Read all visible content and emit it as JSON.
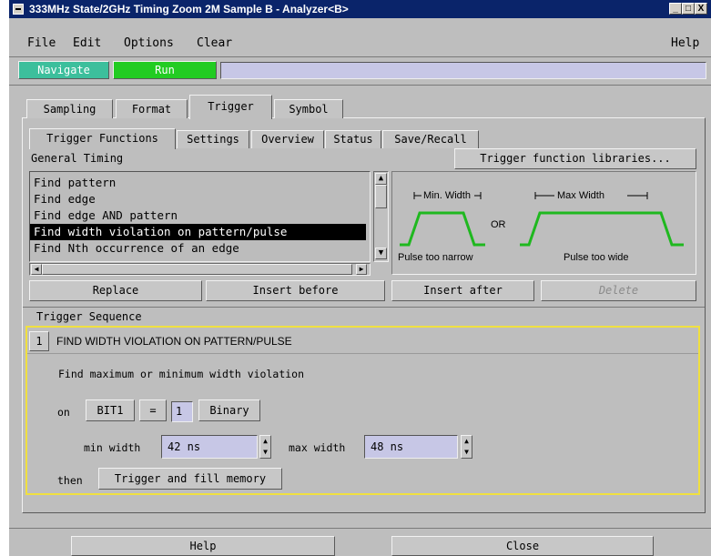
{
  "window": {
    "title": "333MHz State/2GHz Timing Zoom 2M Sample B - Analyzer<B>",
    "controls": [
      "_",
      "□",
      "X"
    ]
  },
  "menubar": {
    "items": [
      "File",
      "Edit",
      "Options",
      "Clear"
    ],
    "help": "Help"
  },
  "toolbar": {
    "navigate": "Navigate",
    "run": "Run",
    "status_text": ""
  },
  "main_tabs": [
    {
      "label": "Sampling"
    },
    {
      "label": "Format"
    },
    {
      "label": "Trigger"
    },
    {
      "label": "Symbol"
    }
  ],
  "sub_tabs": [
    {
      "label": "Trigger Functions"
    },
    {
      "label": "Settings"
    },
    {
      "label": "Overview"
    },
    {
      "label": "Status"
    },
    {
      "label": "Save/Recall"
    }
  ],
  "functions": {
    "category": "General Timing",
    "libraries_button": "Trigger function libraries...",
    "items": [
      {
        "label": "Find pattern"
      },
      {
        "label": "Find edge"
      },
      {
        "label": "Find edge AND pattern"
      },
      {
        "label": "Find width violation on pattern/pulse"
      },
      {
        "label": "Find Nth occurrence of an edge"
      }
    ],
    "selected": "Find width violation on pattern/pulse"
  },
  "diagram": {
    "min_width_label": "Min. Width",
    "max_width_label": "Max Width",
    "or_label": "OR",
    "narrow_caption": "Pulse too narrow",
    "wide_caption": "Pulse too wide",
    "pulse_color": "#1fb81f"
  },
  "actions": {
    "replace": "Replace",
    "insert_before": "Insert before",
    "insert_after": "Insert after",
    "delete": "Delete"
  },
  "sequence": {
    "title": "Trigger Sequence",
    "step_number": "1",
    "step_title": "FIND WIDTH VIOLATION ON PATTERN/PULSE",
    "description": "Find maximum or minimum width violation",
    "on_label": "on",
    "bus": "BIT1",
    "operator": "=",
    "value": "1",
    "base": "Binary",
    "min_width_label": "min width",
    "min_width_value": "42 ns",
    "max_width_label": "max width",
    "max_width_value": "48 ns",
    "then_label": "then",
    "action": "Trigger and fill memory",
    "border_color": "#f0e040"
  },
  "footer": {
    "help": "Help",
    "close": "Close"
  },
  "colors": {
    "navigate_bg": "#3cbf9c",
    "run_bg": "#22cc22",
    "title_bg": "#0a246a",
    "field_bg": "#c7c7e6"
  }
}
